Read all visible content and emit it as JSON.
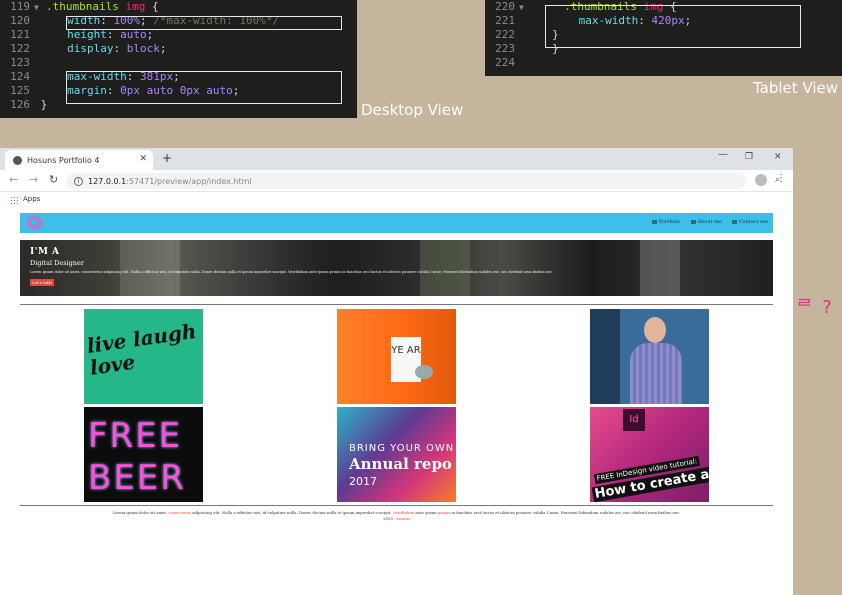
{
  "desktop_code": {
    "lines": [
      {
        "num": "119",
        "fold": "▼",
        "sel": ".thumbnails",
        "tag": "img",
        "rest": " {"
      },
      {
        "num": "120",
        "prop": "width",
        "val": "100%",
        "semi": ";",
        "comment": " /*max-width: 100%*/"
      },
      {
        "num": "121",
        "prop": "height",
        "val": "auto",
        "semi": ";"
      },
      {
        "num": "122",
        "prop": "display",
        "val": "block",
        "semi": ";"
      },
      {
        "num": "123"
      },
      {
        "num": "124",
        "prop": "max-width",
        "val": "381px",
        "semi": ";"
      },
      {
        "num": "125",
        "prop": "margin",
        "val": "0px auto 0px auto",
        "semi": ";"
      },
      {
        "num": "126",
        "close": "}"
      }
    ]
  },
  "tablet_code": {
    "lines": [
      {
        "num": "220",
        "fold": "▼",
        "sel": ".thumbnails",
        "tag": "img",
        "rest": " {"
      },
      {
        "num": "221",
        "prop": "max-width",
        "val": "420px",
        "semi": ";"
      },
      {
        "num": "222",
        "close": "}"
      },
      {
        "num": "223",
        "close": "}"
      },
      {
        "num": "224"
      }
    ]
  },
  "captions": {
    "desktop": "Desktop View",
    "tablet": "Tablet View"
  },
  "side_note": "ᄅ ?",
  "browser": {
    "tab_title": "Hosuns Portfolio 4",
    "close_glyph": "✕",
    "new_tab": "+",
    "controls": {
      "minimize": "—",
      "maximize": "❐",
      "close": "✕"
    },
    "url": {
      "host": "127.0.0.1",
      "path": ":57471/preview/app/index.html"
    },
    "bookmarks_label": "Apps"
  },
  "site": {
    "nav": [
      "Portfolio",
      "About me",
      "Contact me"
    ],
    "hero": {
      "title": "I'M A",
      "subtitle": "Digital Designer",
      "body": "Lorem ipsum dolor sit amet, consectetur adipiscing elit. Nulla a efficitur nisi, id vulputate nulla. Donec dictum nulla et ipsum imperdiet suscipit. Vestibulum ante ipsum primis in faucibus orci luctus et ultrices posuere cubilia Curae; Praesent bibendum sodales est, nec eleifend urna finibus nec.",
      "cta": "Let's talk!"
    },
    "thumbs": {
      "t1": "live laugh love",
      "t2_panel": "YE AR",
      "t4": "FREE BEER",
      "t5_line1": "BRING YOUR OWN B",
      "t5_line2": "Annual repo",
      "t5_line3": "2017",
      "t6_badge": "Id",
      "t6_cap1": "FREE InDesign video tutorial:",
      "t6_cap2": "How to create a"
    },
    "footer": {
      "text1": "Lorem ipsum dolor sit amet, ",
      "link1": "consectetur",
      "text2": " adipiscing elit. Nulla a efficitur nisi, id vulputate nulla. Donec dictum nulla et ipsum imperdiet suscipit. ",
      "link2": "Vestibulum",
      "text3": " ante ipsum ",
      "link3": "primis",
      "text4": " in faucibus orci luctus et ultrices posuere cubilia Curae; Praesent bibendum sodales est, nec eleifend urna finibus nec.",
      "text5": "2019 · ",
      "link5": "hosuns"
    }
  },
  "colors": {
    "header": "#3cbfea",
    "accent": "#e8483b",
    "code_bg": "#1e1f1c"
  }
}
